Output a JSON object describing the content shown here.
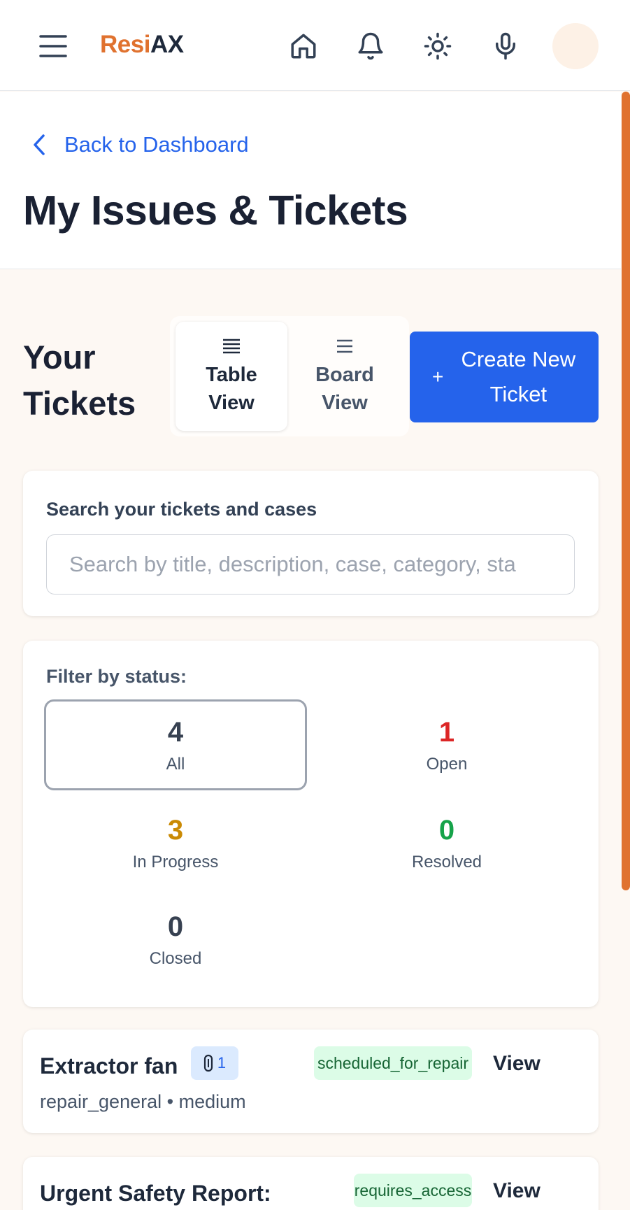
{
  "header": {
    "brand_part1": "Resi",
    "brand_part2": "AX",
    "icons": [
      "menu-icon",
      "home-icon",
      "bell-icon",
      "sun-icon",
      "microphone-icon"
    ],
    "accent_color": "#e0722f"
  },
  "navigation": {
    "back_label": "Back to Dashboard"
  },
  "page": {
    "title": "My Issues & Tickets"
  },
  "tickets_section": {
    "title": "Your Tickets",
    "views": [
      {
        "label": "Table View",
        "active": true,
        "icon": "table-list-icon"
      },
      {
        "label": "Board View",
        "active": false,
        "icon": "board-list-icon"
      }
    ],
    "create_button": {
      "icon": "+",
      "label": "Create New Ticket",
      "color": "#2563eb"
    }
  },
  "search": {
    "label": "Search your tickets and cases",
    "placeholder": "Search by title, description, case, category, sta",
    "value": ""
  },
  "filter": {
    "label": "Filter by status:",
    "stats": [
      {
        "count": "4",
        "label": "All",
        "color": "#374151",
        "selected": true
      },
      {
        "count": "1",
        "label": "Open",
        "color": "#dc2626",
        "selected": false
      },
      {
        "count": "3",
        "label": "In Progress",
        "color": "#ca8a04",
        "selected": false
      },
      {
        "count": "0",
        "label": "Resolved",
        "color": "#16a34a",
        "selected": false
      },
      {
        "count": "0",
        "label": "Closed",
        "color": "#374151",
        "selected": false
      }
    ]
  },
  "tickets": [
    {
      "title": "Extractor fan",
      "attachments": "1",
      "meta": "repair_general • medium",
      "status": "scheduled_for_repair",
      "action": "View"
    },
    {
      "title": "Urgent Safety Report:",
      "meta": "",
      "status": "requires_access",
      "action": "View"
    }
  ]
}
